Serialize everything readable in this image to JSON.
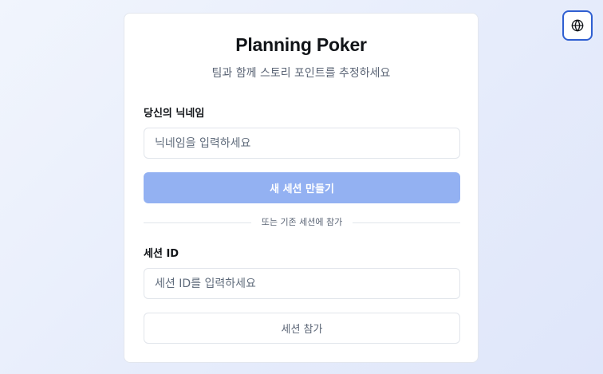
{
  "app": {
    "title": "Planning Poker",
    "subtitle": "팀과 함께 스토리 포인트를 추정하세요"
  },
  "create": {
    "nickname_label": "당신의 닉네임",
    "nickname_value": "",
    "nickname_placeholder": "닉네임을 입력하세요",
    "create_button_label": "새 세션 만들기"
  },
  "divider": {
    "text": "또는 기존 세션에 참가"
  },
  "join": {
    "session_id_label": "세션 ID",
    "session_id_value": "",
    "session_id_placeholder": "세션 ID를 입력하세요",
    "join_button_label": "세션 참가"
  },
  "language_button": {
    "icon": "globe-icon"
  },
  "colors": {
    "primary_disabled": "#93b1f2",
    "accent_border": "#2f5fd1"
  }
}
